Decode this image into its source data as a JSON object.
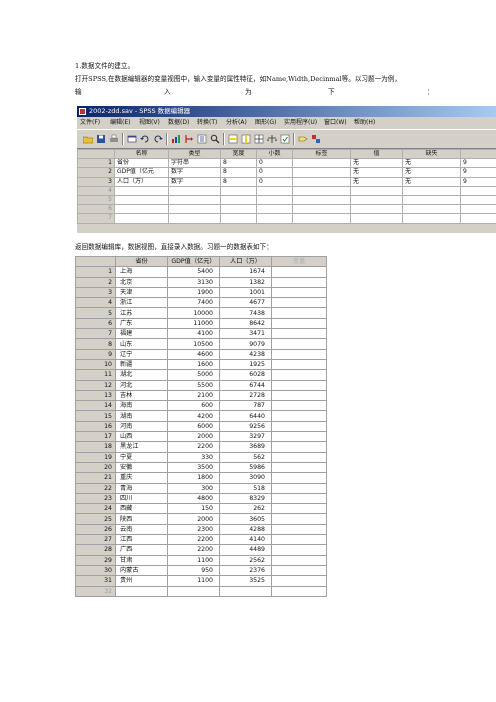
{
  "doc": {
    "step_title": "1.数据文件的建立。",
    "step_text": "打开SPSS,在数据编辑器的变量视图中，输入变量的属性特征，如Name,Width,Decinmal等。以习题一为例，",
    "spaced_line": [
      "输",
      "入",
      "为",
      "下",
      "："
    ],
    "data_intro": "返回数据编辑库，数据视图，直接录入数据。习题一的数据表如下："
  },
  "window": {
    "title": "2002-zdd.sav - SPSS 数据编辑器",
    "menu": [
      "文件(F)",
      "编辑(E)",
      "视图(V)",
      "数据(D)",
      "转换(T)",
      "分析(A)",
      "图形(G)",
      "实用程序(U)",
      "窗口(W)",
      "帮助(H)"
    ],
    "toolbar_icons": [
      "open-folder-icon",
      "save-disk-icon",
      "print-icon",
      "dialog-recall-icon",
      "undo-icon",
      "redo-icon",
      "goto-chart-icon",
      "goto-case-icon",
      "variables-icon",
      "find-icon",
      "insert-case-icon",
      "insert-variable-icon",
      "split-file-icon",
      "weight-cases-icon",
      "select-cases-icon",
      "value-labels-icon",
      "use-sets-icon"
    ]
  },
  "variable_view": {
    "columns": [
      "",
      "名称",
      "类型",
      "宽度",
      "小数",
      "标签",
      "值",
      "缺失",
      ""
    ],
    "rows": [
      {
        "num": "1",
        "name": "省份",
        "type": "字符串",
        "width": "8",
        "decimals": "0",
        "label": "",
        "values": "无",
        "missing": "无",
        "extra": "9"
      },
      {
        "num": "2",
        "name": "GDP值（亿元",
        "type": "数字",
        "width": "8",
        "decimals": "0",
        "label": "",
        "values": "无",
        "missing": "无",
        "extra": "9"
      },
      {
        "num": "3",
        "name": "人口（万）",
        "type": "数字",
        "width": "8",
        "decimals": "0",
        "label": "",
        "values": "无",
        "missing": "无",
        "extra": "9"
      },
      {
        "num": "4",
        "name": "",
        "type": "",
        "width": "",
        "decimals": "",
        "label": "",
        "values": "",
        "missing": "",
        "extra": ""
      },
      {
        "num": "5",
        "name": "",
        "type": "",
        "width": "",
        "decimals": "",
        "label": "",
        "values": "",
        "missing": "",
        "extra": ""
      },
      {
        "num": "6",
        "name": "",
        "type": "",
        "width": "",
        "decimals": "",
        "label": "",
        "values": "",
        "missing": "",
        "extra": ""
      },
      {
        "num": "7",
        "name": "",
        "type": "",
        "width": "",
        "decimals": "",
        "label": "",
        "values": "",
        "missing": "",
        "extra": ""
      }
    ]
  },
  "data_view": {
    "columns": [
      "",
      "省份",
      "GDP值（亿元）",
      "人口（万）",
      "变量"
    ],
    "rows": [
      [
        "1",
        "上海",
        "5400",
        "1674"
      ],
      [
        "2",
        "北京",
        "3130",
        "1382"
      ],
      [
        "3",
        "天津",
        "1900",
        "1001"
      ],
      [
        "4",
        "浙江",
        "7400",
        "4677"
      ],
      [
        "5",
        "江苏",
        "10000",
        "7438"
      ],
      [
        "6",
        "广东",
        "11000",
        "8642"
      ],
      [
        "7",
        "福建",
        "4100",
        "3471"
      ],
      [
        "8",
        "山东",
        "10500",
        "9079"
      ],
      [
        "9",
        "辽宁",
        "4600",
        "4238"
      ],
      [
        "10",
        "新疆",
        "1600",
        "1925"
      ],
      [
        "11",
        "湖北",
        "5000",
        "6028"
      ],
      [
        "12",
        "河北",
        "5500",
        "6744"
      ],
      [
        "13",
        "吉林",
        "2100",
        "2728"
      ],
      [
        "14",
        "海南",
        "600",
        "787"
      ],
      [
        "15",
        "湖南",
        "4200",
        "6440"
      ],
      [
        "16",
        "河南",
        "6000",
        "9256"
      ],
      [
        "17",
        "山西",
        "2000",
        "3297"
      ],
      [
        "18",
        "黑龙江",
        "2200",
        "3689"
      ],
      [
        "19",
        "宁夏",
        "330",
        "562"
      ],
      [
        "20",
        "安徽",
        "3500",
        "5986"
      ],
      [
        "21",
        "重庆",
        "1800",
        "3090"
      ],
      [
        "22",
        "青海",
        "300",
        "518"
      ],
      [
        "23",
        "四川",
        "4800",
        "8329"
      ],
      [
        "24",
        "西藏",
        "150",
        "262"
      ],
      [
        "25",
        "陕西",
        "2000",
        "3605"
      ],
      [
        "26",
        "云南",
        "2300",
        "4288"
      ],
      [
        "27",
        "江西",
        "2200",
        "4140"
      ],
      [
        "28",
        "广西",
        "2200",
        "4489"
      ],
      [
        "29",
        "甘肃",
        "1100",
        "2562"
      ],
      [
        "30",
        "内蒙古",
        "950",
        "2376"
      ],
      [
        "31",
        "贵州",
        "1100",
        "3525"
      ],
      [
        "32",
        "",
        "",
        ""
      ]
    ]
  }
}
